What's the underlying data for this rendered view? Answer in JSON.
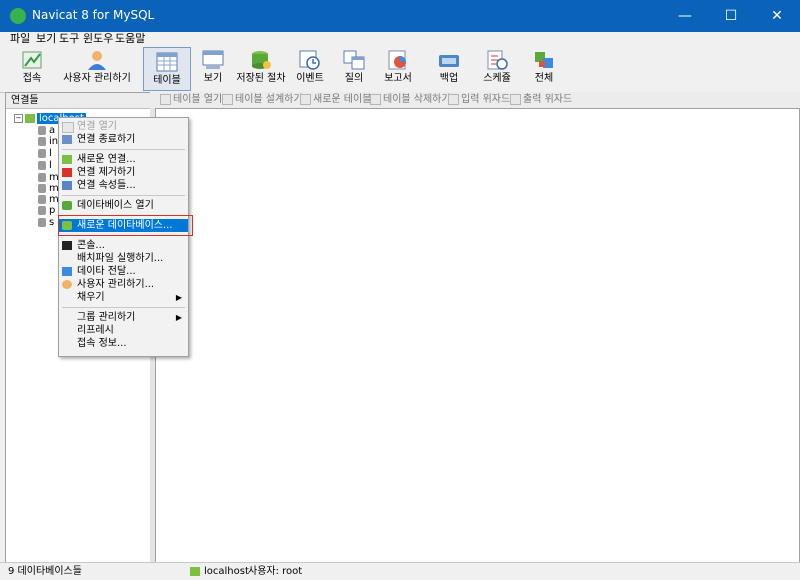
{
  "window": {
    "title": "Navicat 8 for MySQL",
    "minimize": "—",
    "maximize": "☐",
    "close": "✕"
  },
  "menu": [
    "파일",
    "보기",
    "도구",
    "윈도우",
    "도움말"
  ],
  "toolbar": {
    "connect": "접속",
    "user_manager": "사용자 관리하기",
    "tables": "테이블",
    "views": "보기",
    "procedures": "저장된 절차",
    "events": "이벤트",
    "queries": "질의",
    "reports": "보고서",
    "backup": "백업",
    "schedule": "스케쥴",
    "all": "전체"
  },
  "left": {
    "header": "연결들",
    "connection": "localhost",
    "databases": [
      "a",
      "in",
      "l",
      "l",
      "m",
      "m",
      "m",
      "p",
      "s"
    ]
  },
  "right_toolbar": {
    "open": "테이블 열기",
    "design": "테이블 설계하기",
    "new": "새로운 테이블",
    "delete": "테이블 삭제하기",
    "import": "입력 위자드",
    "export": "출력 위자드"
  },
  "context_menu": {
    "open_connection": "연결 열기",
    "close_connection": "연결 종료하기",
    "new_connection": "새로운 연결...",
    "delete_connection": "연결 제거하기",
    "connection_properties": "연결 속성들...",
    "open_database": "데이타베이스 열기",
    "new_database": "새로운 데이타베이스...",
    "console": "콘솔...",
    "run_batch": "배치파일 실행하기...",
    "data_transfer": "데이타 전달...",
    "user_manager": "사용자 관리하기...",
    "fill": "채우기",
    "group_manager": "그룹 관리하기",
    "refresh": "리프레시",
    "connection_info": "접속 정보..."
  },
  "status": {
    "db_count": "9 데이타베이스들",
    "connection": "localhost",
    "user": "사용자: root"
  },
  "colors": {
    "titlebar": "#0a63b8",
    "highlight": "#0078d7",
    "frame": "#d9302a"
  }
}
